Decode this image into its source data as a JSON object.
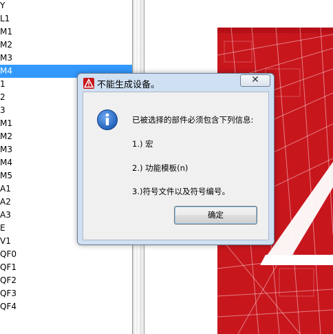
{
  "tree": {
    "items": [
      {
        "label": "Y"
      },
      {
        "label": "L1"
      },
      {
        "label": "M1"
      },
      {
        "label": "M2"
      },
      {
        "label": "M3"
      },
      {
        "label": "M4",
        "selected": true
      },
      {
        "label": "1"
      },
      {
        "label": "2"
      },
      {
        "label": "3"
      },
      {
        "label": "M1"
      },
      {
        "label": "M2"
      },
      {
        "label": "M3"
      },
      {
        "label": "M4"
      },
      {
        "label": "M5"
      },
      {
        "label": "A1"
      },
      {
        "label": "A2"
      },
      {
        "label": "A3"
      },
      {
        "label": "E"
      },
      {
        "label": "V1"
      },
      {
        "label": "QF0"
      },
      {
        "label": "QF1"
      },
      {
        "label": "QF2"
      },
      {
        "label": "QF3"
      },
      {
        "label": "QF4"
      },
      {
        "label": ""
      }
    ]
  },
  "dialog": {
    "title": "不能生成设备。",
    "close_label": "✕",
    "messages": [
      "已被选择的部件必须包含下列信息:",
      "1.) 宏",
      "2.) 功能模板(n)",
      "3.)符号文件以及符号编号。"
    ],
    "ok_label": "确定"
  },
  "colors": {
    "selection": "#3399ff",
    "banner_red": "#c8161d",
    "info_blue": "#1d5fb8"
  },
  "icons": {
    "title": "warning-triangle-icon",
    "message": "info-icon",
    "close": "close-icon"
  }
}
